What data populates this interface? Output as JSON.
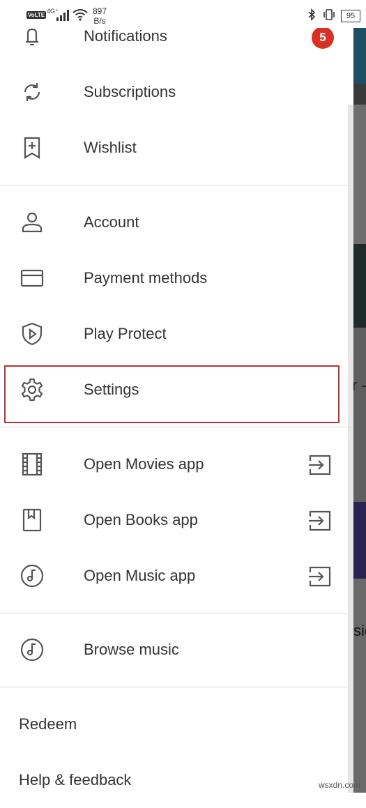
{
  "status_bar": {
    "volte": "VoLTE",
    "network": "4G⁺",
    "speed_value": "897",
    "speed_unit": "B/s",
    "battery": "95"
  },
  "menu": {
    "notifications": {
      "label": "Notifications",
      "badge": "5"
    },
    "subscriptions": "Subscriptions",
    "wishlist": "Wishlist",
    "account": "Account",
    "payment_methods": "Payment methods",
    "play_protect": "Play Protect",
    "settings": "Settings",
    "open_movies": "Open Movies app",
    "open_books": "Open Books app",
    "open_music": "Open Music app",
    "browse_music": "Browse music",
    "redeem": "Redeem",
    "help_feedback": "Help & feedback"
  },
  "background": {
    "text1": "r - sca",
    "text2": "sic"
  },
  "watermark": "wsxdn.com",
  "colors": {
    "accent": "#d93025",
    "highlight": "#b5333a",
    "icon": "#555555",
    "text": "#333333"
  }
}
